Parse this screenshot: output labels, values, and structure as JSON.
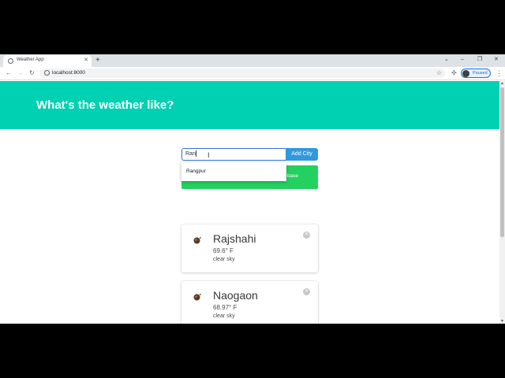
{
  "browser": {
    "tab_title": "Weather App",
    "url": "localhost:8000",
    "profile_label": "Paused",
    "new_tab": "+",
    "tab_close": "✕",
    "minimize": "–",
    "maximize": "❐",
    "close": "✕",
    "back": "←",
    "forward": "→",
    "reload": "↻",
    "star": "☆",
    "extensions": "✣",
    "menu": "⋮"
  },
  "page": {
    "title": "What's the weather like?",
    "input_value": "Ran",
    "add_button": "Add City",
    "autocomplete_option": "Rangpur",
    "hidden_notice_fragment": "base"
  },
  "cities": [
    {
      "name": "Rajshahi",
      "temp": "69.6° F",
      "description": "clear sky"
    },
    {
      "name": "Naogaon",
      "temp": "68.97° F",
      "description": "clear sky"
    }
  ],
  "colors": {
    "hero": "#00d1b2",
    "add_button": "#3298dc",
    "notification": "#23d160"
  }
}
